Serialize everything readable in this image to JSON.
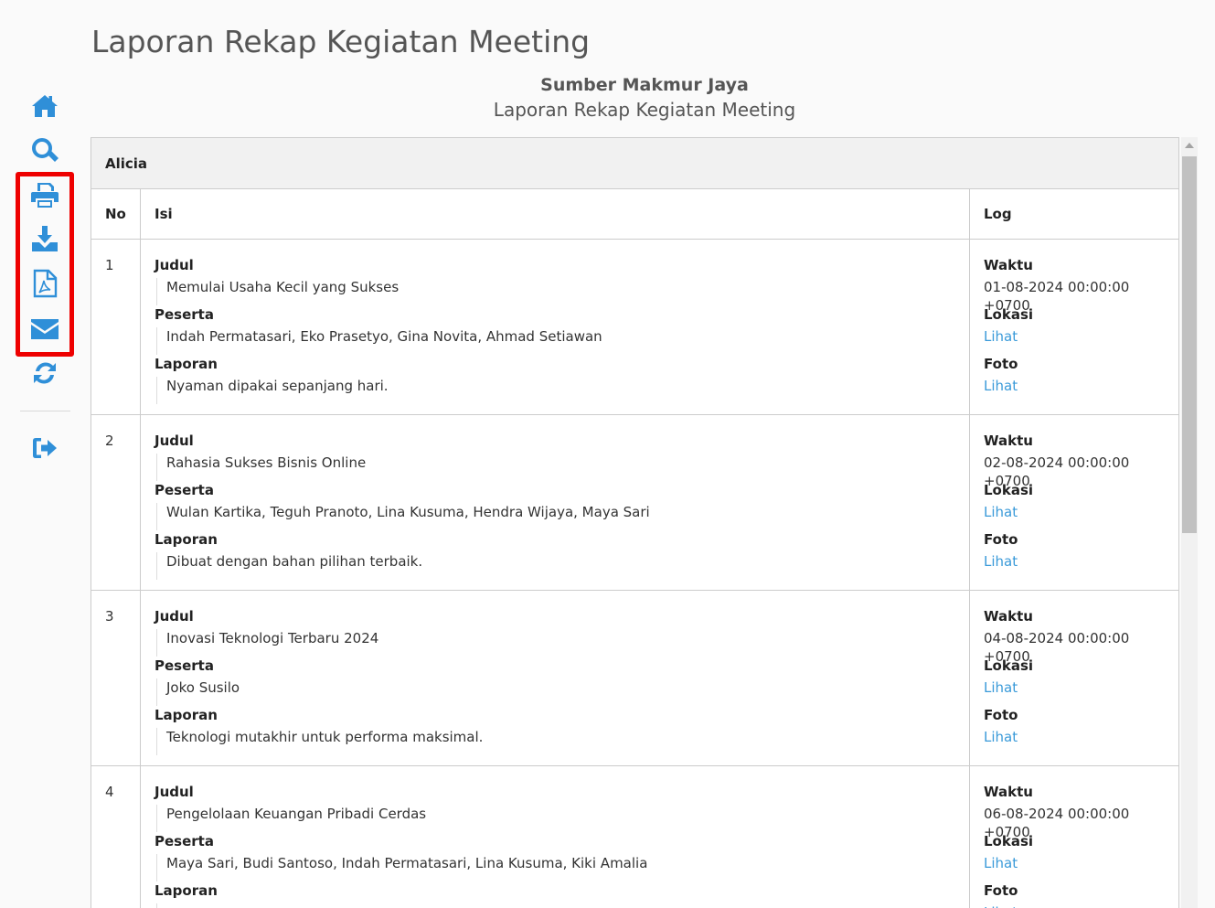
{
  "page": {
    "title": "Laporan Rekap Kegiatan Meeting"
  },
  "report": {
    "company": "Sumber Makmur Jaya",
    "subtitle": "Laporan Rekap Kegiatan Meeting"
  },
  "sidebar": {
    "icons": [
      "home-icon",
      "search-icon",
      "print-icon",
      "download-icon",
      "pdf-icon",
      "email-icon",
      "refresh-icon",
      "logout-icon"
    ],
    "accent_color": "#2f8fd8",
    "highlight_color": "#ee0000"
  },
  "table": {
    "group": "Alicia",
    "headers": {
      "no": "No",
      "isi": "Isi",
      "log": "Log"
    },
    "field_labels": {
      "judul": "Judul",
      "peserta": "Peserta",
      "laporan": "Laporan",
      "waktu": "Waktu",
      "lokasi": "Lokasi",
      "foto": "Foto",
      "link": "Lihat"
    },
    "rows": [
      {
        "no": "1",
        "judul": "Memulai Usaha Kecil yang Sukses",
        "peserta": "Indah Permatasari, Eko Prasetyo, Gina Novita, Ahmad Setiawan",
        "laporan": "Nyaman dipakai sepanjang hari.",
        "waktu": "01-08-2024 00:00:00 +0700"
      },
      {
        "no": "2",
        "judul": "Rahasia Sukses Bisnis Online",
        "peserta": "Wulan Kartika, Teguh Pranoto, Lina Kusuma, Hendra Wijaya, Maya Sari",
        "laporan": "Dibuat dengan bahan pilihan terbaik.",
        "waktu": "02-08-2024 00:00:00 +0700"
      },
      {
        "no": "3",
        "judul": "Inovasi Teknologi Terbaru 2024",
        "peserta": "Joko Susilo",
        "laporan": "Teknologi mutakhir untuk performa maksimal.",
        "waktu": "04-08-2024 00:00:00 +0700"
      },
      {
        "no": "4",
        "judul": "Pengelolaan Keuangan Pribadi Cerdas",
        "peserta": "Maya Sari, Budi Santoso, Indah Permatasari, Lina Kusuma, Kiki Amalia",
        "laporan": "",
        "waktu": "06-08-2024 00:00:00 +0700"
      }
    ]
  },
  "colors": {
    "link": "#3a9ad9",
    "border": "#cccccc",
    "group_bg": "#f1f1f1"
  }
}
